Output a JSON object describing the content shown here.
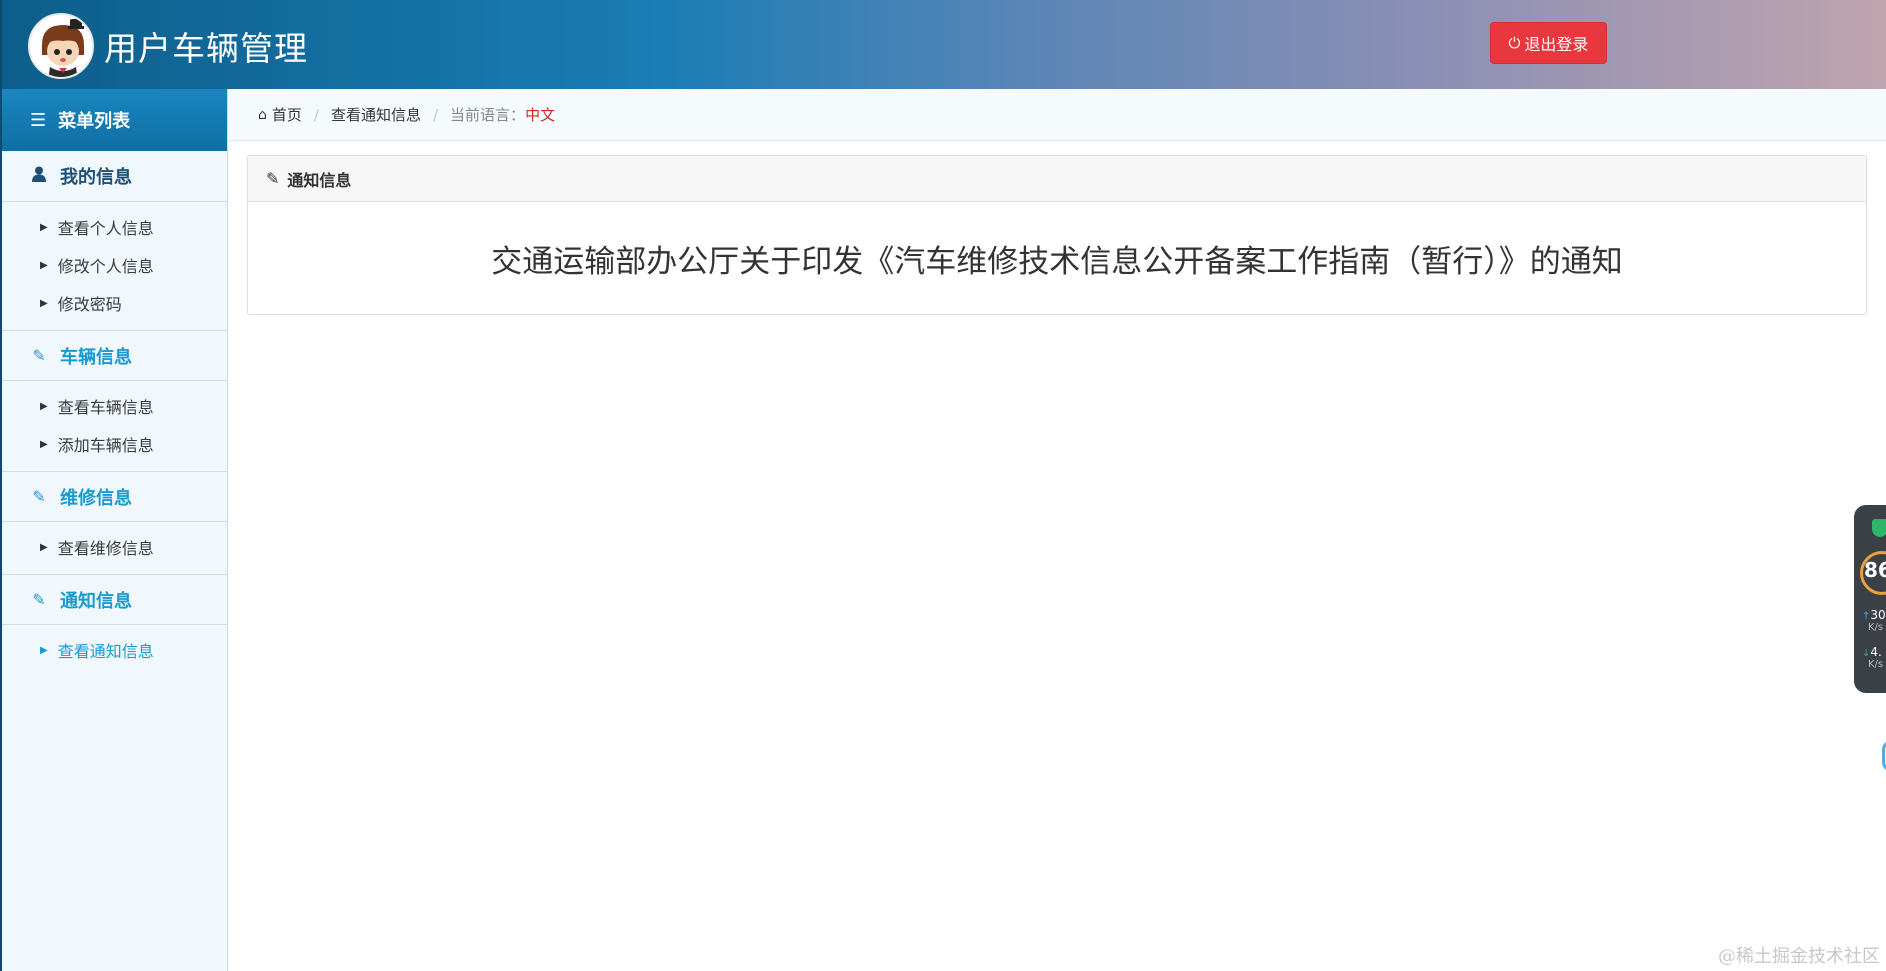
{
  "header": {
    "app_title": "用户车辆管理",
    "logout_label": "退出登录"
  },
  "sidebar": {
    "title": "菜单列表",
    "groups": [
      {
        "title": "我的信息",
        "items": [
          "查看个人信息",
          "修改个人信息",
          "修改密码"
        ]
      },
      {
        "title": "车辆信息",
        "items": [
          "查看车辆信息",
          "添加车辆信息"
        ]
      },
      {
        "title": "维修信息",
        "items": [
          "查看维修信息"
        ]
      },
      {
        "title": "通知信息",
        "items": [
          "查看通知信息"
        ]
      }
    ]
  },
  "breadcrumb": {
    "home": "首页",
    "current": "查看通知信息",
    "lang_label": "当前语言：",
    "lang_value": "中文"
  },
  "panel": {
    "title": "通知信息",
    "notice": "交通运输部办公厅关于印发《汽车维修技术信息公开备案工作指南（暂行）》的通知"
  },
  "widget": {
    "score": "86",
    "upload": "30",
    "upload_unit": "K/s",
    "download": "4.",
    "download_unit": "K/s"
  },
  "watermark": "@稀土掘金技术社区",
  "colors": {
    "accent": "#1a9bd0",
    "logout": "#e8383d",
    "lang": "#d12b2b"
  }
}
